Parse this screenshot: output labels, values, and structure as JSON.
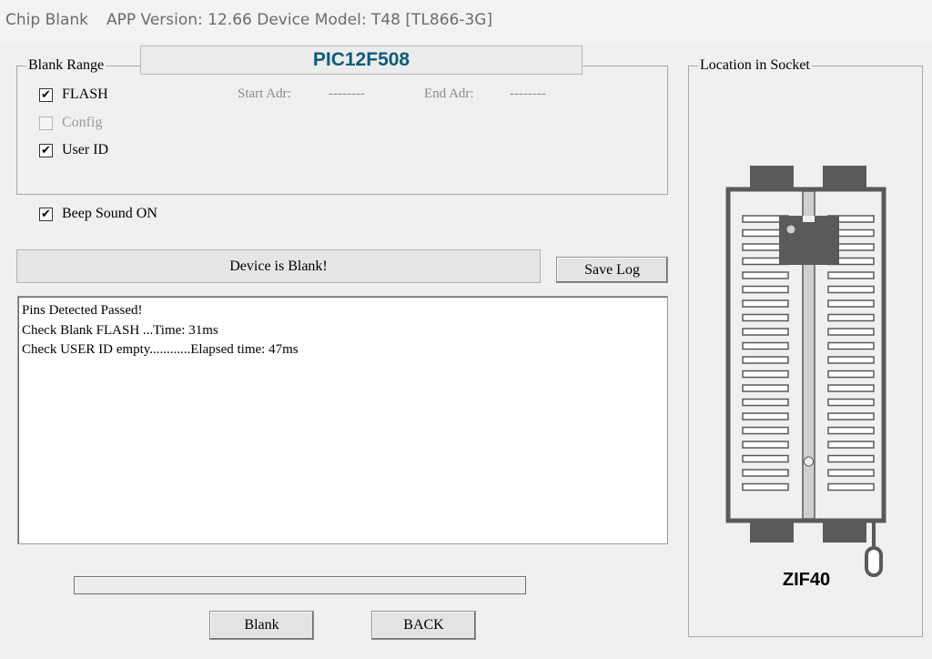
{
  "window": {
    "title": "Chip Blank",
    "version": "APP Version: 12.66 Device Model: T48 [TL866-3G]"
  },
  "chip": {
    "name": "PIC12F508"
  },
  "blank_range": {
    "legend": "Blank Range",
    "options": [
      {
        "label": "FLASH",
        "checked": true,
        "enabled": true
      },
      {
        "label": "Config",
        "checked": false,
        "enabled": false
      },
      {
        "label": "User ID",
        "checked": true,
        "enabled": true
      }
    ],
    "start_label": "Start Adr:",
    "start_value": "--------",
    "end_label": "End Adr:",
    "end_value": "--------"
  },
  "beep": {
    "label": "Beep Sound ON",
    "checked": true
  },
  "status": {
    "text": "Device is Blank!"
  },
  "buttons": {
    "save_log": "Save Log",
    "blank": "Blank",
    "back": "BACK"
  },
  "log": {
    "lines": [
      "Pins Detected Passed!",
      "Check Blank FLASH ...Time: 31ms",
      "Check USER ID empty............Elapsed time: 47ms"
    ]
  },
  "progress": {
    "fraction": 0
  },
  "socket": {
    "legend": "Location in Socket",
    "label": "ZIF40"
  },
  "colors": {
    "chip_name": "#0e5c78",
    "socket": "#5a5a5a",
    "pin_fill": "#ffffff"
  }
}
